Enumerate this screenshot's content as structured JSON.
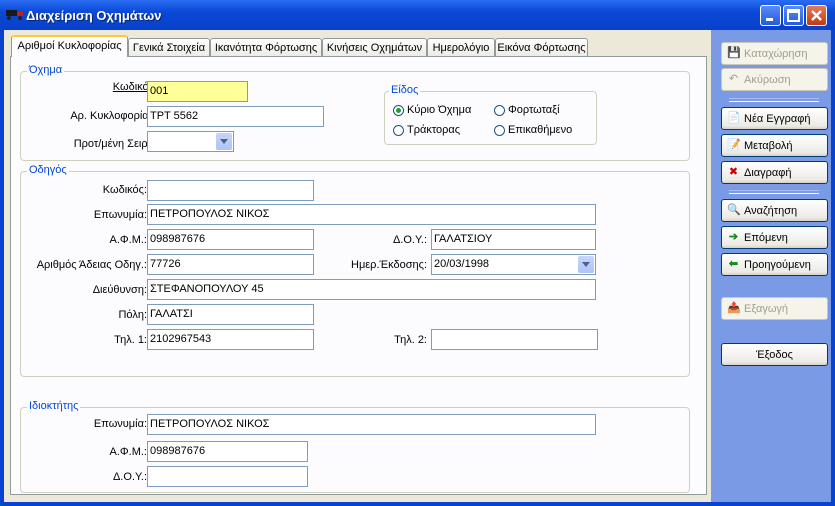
{
  "window": {
    "title": "Διαχείριση Οχημάτων"
  },
  "tabs": [
    {
      "label": "Αριθμοί Κυκλοφορίας"
    },
    {
      "label": "Γενικά Στοιχεία"
    },
    {
      "label": "Ικανότητα Φόρτωσης"
    },
    {
      "label": "Κινήσεις Οχημάτων"
    },
    {
      "label": "Ημερολόγιο"
    },
    {
      "label": "Εικόνα Φόρτωσης"
    }
  ],
  "vehicle": {
    "group_label": "Όχημα",
    "code_label": "Κωδικός:",
    "code_value": "001",
    "plate_label": "Αρ. Κυκλοφορίας:",
    "plate_value": "ΤΡΤ 5562",
    "series_label": "Προτ/μένη Σειρά:",
    "series_value": "",
    "type": {
      "group_label": "Είδος",
      "options": [
        {
          "label": "Κύριο Όχημα",
          "selected": true
        },
        {
          "label": "Φορτωταξί",
          "selected": false
        },
        {
          "label": "Τράκτορας",
          "selected": false
        },
        {
          "label": "Επικαθήμενο",
          "selected": false
        }
      ]
    }
  },
  "driver": {
    "group_label": "Οδηγός",
    "code_label": "Κωδικός:",
    "code_value": "",
    "name_label": "Επωνυμία:",
    "name_value": "ΠΕΤΡΟΠΟΥΛΟΣ ΝΙΚΟΣ",
    "afm_label": "Α.Φ.Μ.:",
    "afm_value": "098987676",
    "doy_label": "Δ.Ο.Υ.:",
    "doy_value": "ΓΑΛΑΤΣΙΟΥ",
    "license_label": "Αριθμός Άδειας Οδηγ.:",
    "license_value": "77726",
    "issue_label": "Ημερ.Έκδοσης:",
    "issue_value": "20/03/1998",
    "address_label": "Διεύθυνση:",
    "address_value": "ΣΤΕΦΑΝΟΠΟΥΛΟΥ 45",
    "city_label": "Πόλη:",
    "city_value": "ΓΑΛΑΤΣΙ",
    "phone1_label": "Τηλ. 1:",
    "phone1_value": "2102967543",
    "phone2_label": "Τηλ. 2:",
    "phone2_value": ""
  },
  "owner": {
    "group_label": "Ιδιοκτήτης",
    "name_label": "Επωνυμία:",
    "name_value": "ΠΕΤΡΟΠΟΥΛΟΣ ΝΙΚΟΣ",
    "afm_label": "Α.Φ.Μ.:",
    "afm_value": "098987676",
    "doy_label": "Δ.Ο.Υ.:",
    "doy_value": ""
  },
  "sidebar": {
    "save": "Καταχώρηση",
    "cancel": "Ακύρωση",
    "new": "Νέα Εγγραφή",
    "edit": "Μεταβολή",
    "delete": "Διαγραφή",
    "search": "Αναζήτηση",
    "next": "Επόμενη",
    "previous": "Προηγούμενη",
    "export": "Εξαγωγή",
    "exit": "Έξοδος"
  }
}
